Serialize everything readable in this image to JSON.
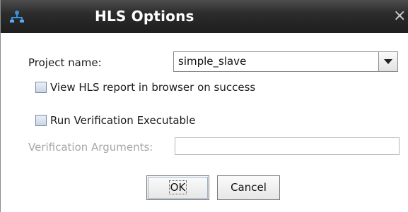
{
  "window": {
    "title": "HLS Options",
    "close_glyph": "×"
  },
  "form": {
    "project_label": "Project name:",
    "project_value": "simple_slave",
    "view_report_label": "View HLS report in browser on success",
    "view_report_checked": false,
    "run_verification_label": "Run Verification Executable",
    "run_verification_checked": false,
    "verification_args_label": "Verification Arguments:",
    "verification_args_value": ""
  },
  "buttons": {
    "ok_label": "OK",
    "cancel_label": "Cancel"
  },
  "icons": {
    "app": "network-icon",
    "close": "close-icon",
    "dropdown": "chevron-down-icon"
  },
  "colors": {
    "titlebar": "#2c2c2c",
    "title_text": "#ffffff",
    "disabled_text": "#a6a6a6",
    "icon_blue": "#3d8fe0"
  }
}
